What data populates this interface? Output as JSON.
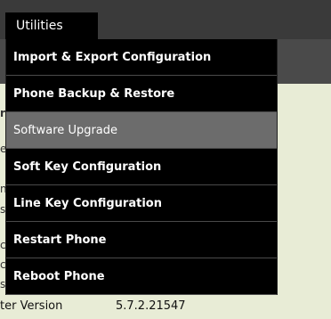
{
  "navbar": {
    "tab_label": "Utilities"
  },
  "menu": {
    "items": [
      {
        "label": "Import & Export Configuration"
      },
      {
        "label": "Phone Backup & Restore"
      },
      {
        "label": "Software Upgrade"
      },
      {
        "label": "Soft Key Configuration"
      },
      {
        "label": "Line Key Configuration"
      },
      {
        "label": "Restart Phone"
      },
      {
        "label": "Reboot Phone"
      }
    ]
  },
  "background": {
    "bottom_label": "ter Version",
    "bottom_value": "5.7.2.21547"
  },
  "colors": {
    "menu_bg": "#000000",
    "menu_active": "#6c6c6c",
    "page_bg": "#e8ecd6"
  }
}
